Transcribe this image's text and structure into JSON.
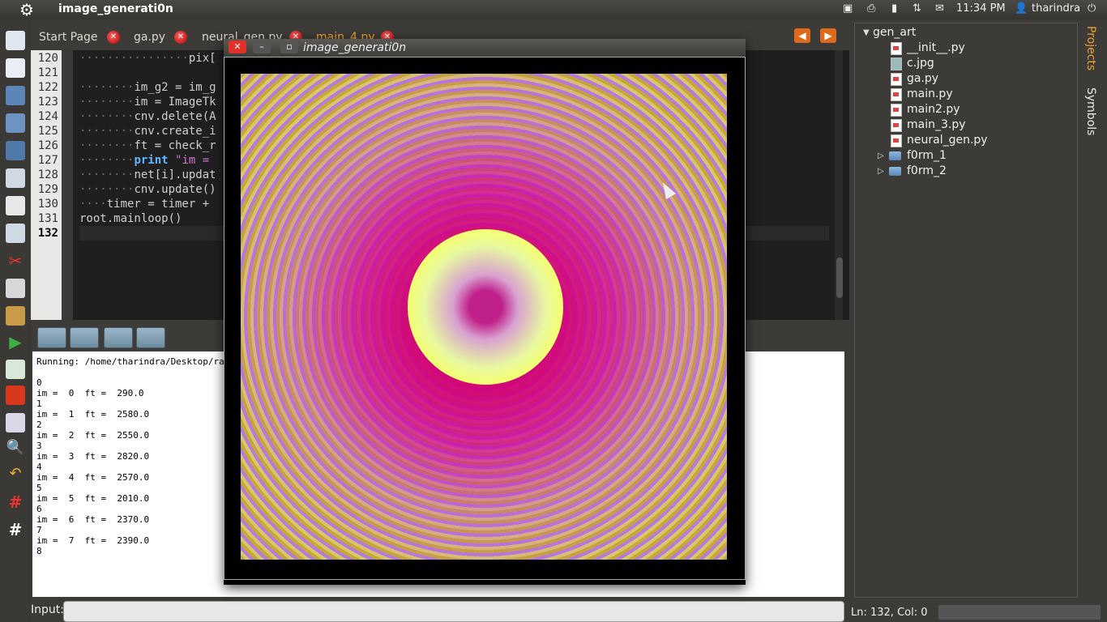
{
  "top_panel": {
    "app_title": "image_generati0n",
    "time": "11:34 PM",
    "user": "tharindra"
  },
  "tabs": [
    {
      "label": "Start Page"
    },
    {
      "label": "ga.py"
    },
    {
      "label": "neural_gen.py"
    },
    {
      "label": "main_4.py",
      "active": true
    }
  ],
  "editor": {
    "line_numbers": [
      "120",
      "121",
      "122",
      "123",
      "124",
      "125",
      "126",
      "127",
      "128",
      "129",
      "130",
      "131",
      "132"
    ],
    "current_line": "132",
    "lines": [
      {
        "indent": "················",
        "text": "pix["
      },
      {
        "indent": "",
        "text": ""
      },
      {
        "indent": "········",
        "text": "im_g2 = im_g"
      },
      {
        "indent": "········",
        "text": "im = ImageTk"
      },
      {
        "indent": "········",
        "text": "cnv.delete(A"
      },
      {
        "indent": "········",
        "text": "cnv.create_i"
      },
      {
        "indent": "········",
        "text": "ft = check_r"
      },
      {
        "indent": "········",
        "kw": "print",
        "text": " \"im ="
      },
      {
        "indent": "········",
        "text": "net[i].updat"
      },
      {
        "indent": "········",
        "text": "cnv.update()"
      },
      {
        "indent": "····",
        "text": "timer = timer +"
      },
      {
        "indent": "",
        "text": "root.mainloop()"
      },
      {
        "indent": "",
        "text": ""
      }
    ]
  },
  "output": {
    "lines": [
      "Running: /home/tharindra/Desktop/rabbi",
      "",
      "0",
      "im =  0  ft =  290.0",
      "1",
      "im =  1  ft =  2580.0",
      "2",
      "im =  2  ft =  2550.0",
      "3",
      "im =  3  ft =  2820.0",
      "4",
      "im =  4  ft =  2570.0",
      "5",
      "im =  5  ft =  2010.0",
      "6",
      "im =  6  ft =  2370.0",
      "7",
      "im =  7  ft =  2390.0",
      "8"
    ]
  },
  "input_bar": {
    "label": "Input:"
  },
  "project_tree": {
    "root": "gen_art",
    "files": [
      "__init__.py",
      "c.jpg",
      "ga.py",
      "main.py",
      "main2.py",
      "main_3.py",
      "neural_gen.py"
    ],
    "folders": [
      "f0rm_1",
      "f0rm_2"
    ]
  },
  "side_tabs": {
    "projects": "Projects",
    "symbols": "Symbols"
  },
  "status": {
    "position": "Ln: 132, Col: 0"
  },
  "popup": {
    "title": "image_generati0n"
  },
  "colors": {
    "accent": "#f0a030",
    "panel": "#3c3b37"
  }
}
